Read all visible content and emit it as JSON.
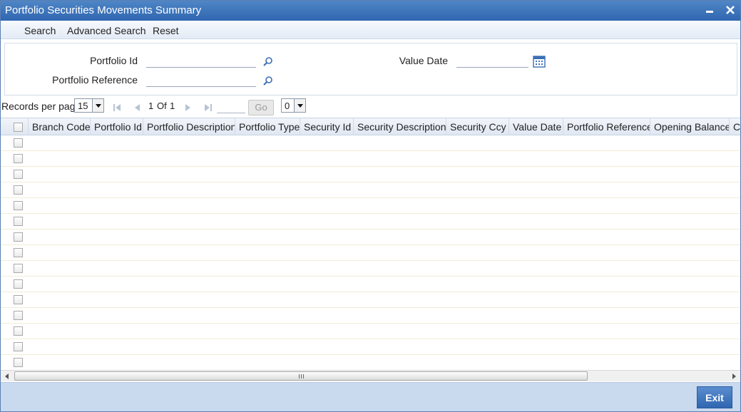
{
  "window": {
    "title": "Portfolio Securities Movements Summary",
    "minimize_label": "▬",
    "close_label": "✕"
  },
  "toolbar": {
    "search": "Search",
    "advanced_search": "Advanced Search",
    "reset": "Reset"
  },
  "search_form": {
    "portfolio_id_label": "Portfolio Id",
    "portfolio_id_value": "",
    "portfolio_reference_label": "Portfolio Reference",
    "portfolio_reference_value": "",
    "value_date_label": "Value Date",
    "value_date_value": ""
  },
  "pager": {
    "records_per_page_label": "Records per page",
    "records_per_page_value": "15",
    "current_page": "1",
    "of_label": "Of",
    "total_pages": "1",
    "go_label": "Go",
    "jump_value": "0"
  },
  "grid": {
    "columns": [
      "Branch Code",
      "Portfolio Id",
      "Portfolio Description",
      "Portfolio Type",
      "Security Id",
      "Security Description",
      "Security Ccy",
      "Value Date",
      "Portfolio Reference",
      "Opening Balance",
      "C"
    ],
    "row_count": 15
  },
  "footer": {
    "exit_label": "Exit"
  },
  "colors": {
    "titlebar": "#2f66b0",
    "toolbar": "#e3ebf6",
    "footer": "#c9d9ee",
    "button": "#2f66b0"
  }
}
